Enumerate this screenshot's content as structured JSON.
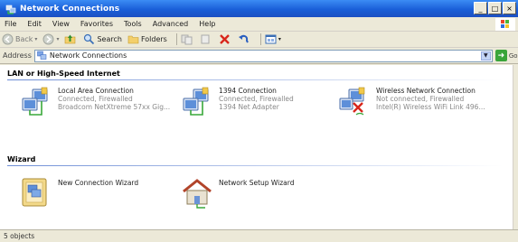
{
  "window": {
    "title": "Network Connections",
    "controls": [
      "_",
      "□",
      "×"
    ]
  },
  "menu": {
    "items": [
      "File",
      "Edit",
      "View",
      "Favorites",
      "Tools",
      "Advanced",
      "Help"
    ]
  },
  "toolbar": {
    "back_label": "Back",
    "search_label": "Search",
    "folders_label": "Folders"
  },
  "address": {
    "label": "Address",
    "value": "Network Connections",
    "go_label": "Go"
  },
  "groups": {
    "lan": {
      "header": "LAN or High-Speed Internet",
      "connections": [
        {
          "name": "Local Area Connection",
          "status": "Connected, Firewalled",
          "device": "Broadcom NetXtreme 57xx Gig..."
        },
        {
          "name": "1394 Connection",
          "status": "Connected, Firewalled",
          "device": "1394 Net Adapter"
        },
        {
          "name": "Wireless Network Connection",
          "status": "Not connected, Firewalled",
          "device": "Intel(R) Wireless WiFi Link 496..."
        }
      ]
    },
    "wizard": {
      "header": "Wizard",
      "items": [
        {
          "label": "New Connection Wizard"
        },
        {
          "label": "Network Setup Wizard"
        }
      ]
    }
  },
  "status": {
    "text": "5 objects"
  },
  "colors": {
    "titlebar": "#1a5fd8",
    "group_rule": "#6e8ed6",
    "error_x": "#d8261c",
    "go_green": "#3aa53a"
  }
}
